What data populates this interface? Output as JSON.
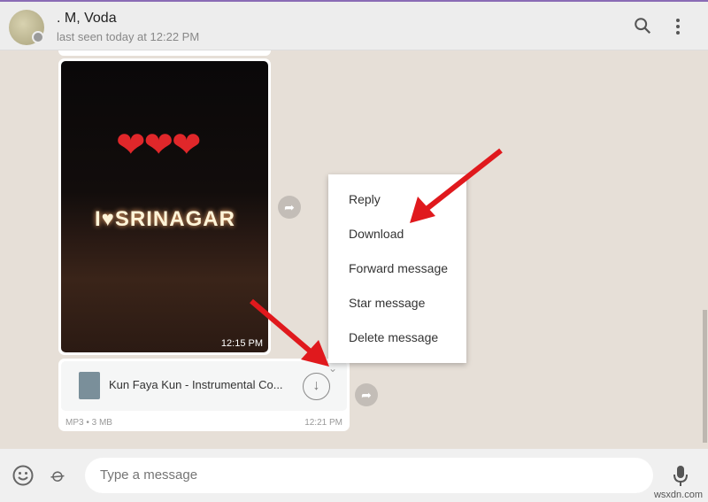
{
  "header": {
    "name": ". M, Voda",
    "status": "last seen today at 12:22 PM",
    "search_icon": "search-icon",
    "menu_icon": "more-vertical-icon"
  },
  "photo": {
    "hearts": "❤❤❤",
    "sign": "I♥SRINAGAR",
    "time": "12:15 PM"
  },
  "document": {
    "name": "Kun Faya Kun - Instrumental Co...",
    "meta": "MP3 • 3 MB",
    "time": "12:21 PM"
  },
  "context_menu": {
    "items": [
      "Reply",
      "Download",
      "Forward message",
      "Star message",
      "Delete message"
    ]
  },
  "composer": {
    "placeholder": "Type a message"
  },
  "watermark": "wsxdn.com",
  "colors": {
    "accent_arrow": "#e0191d",
    "header_bg": "#ededed",
    "chat_bg": "#e6dfd7"
  }
}
